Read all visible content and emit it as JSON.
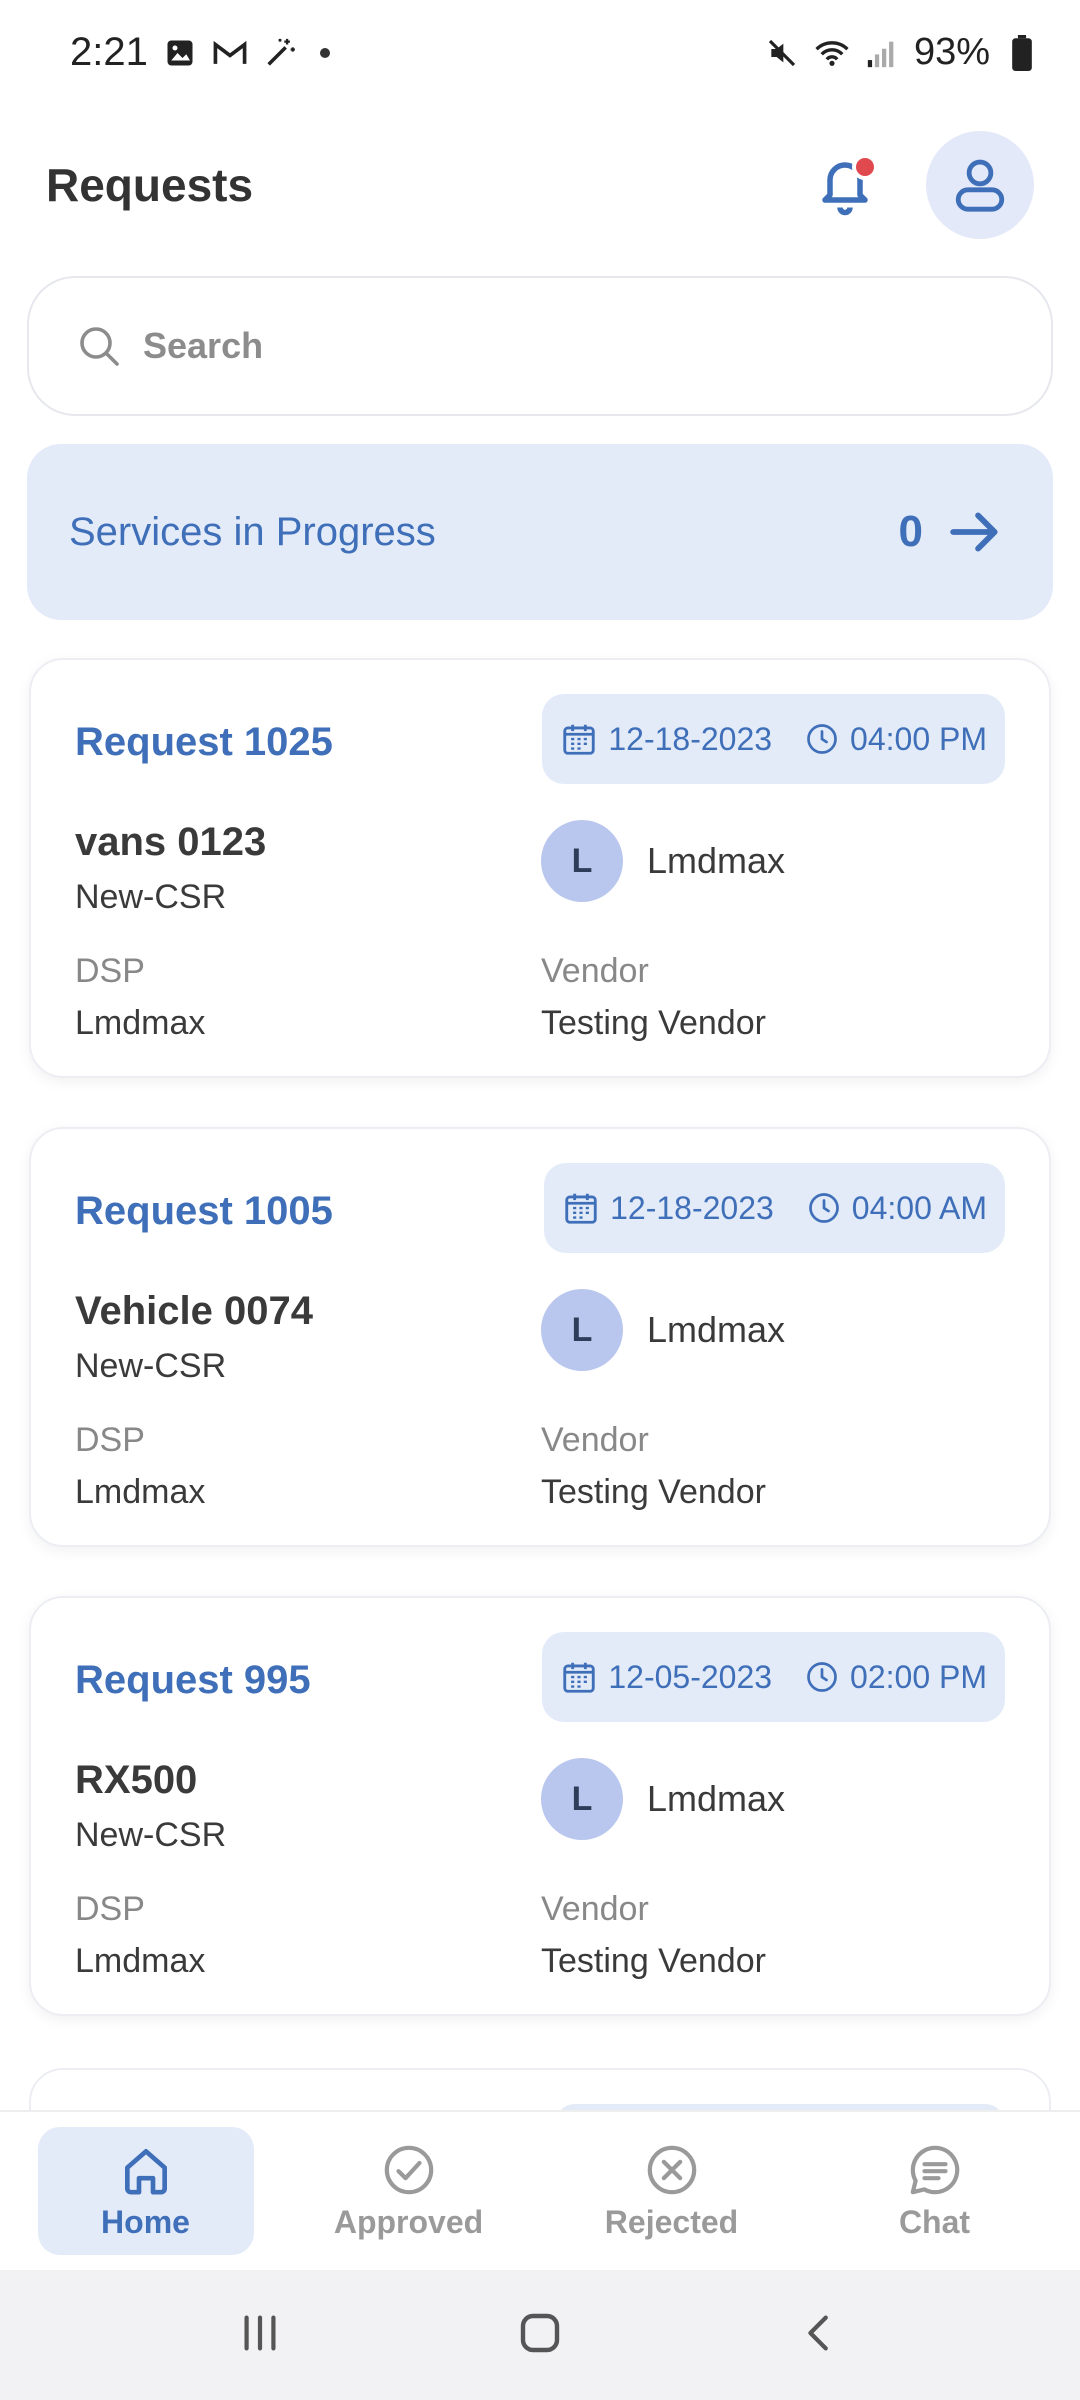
{
  "status_bar": {
    "time": "2:21",
    "battery": "93%"
  },
  "header": {
    "title": "Requests"
  },
  "search": {
    "placeholder": "Search"
  },
  "banner": {
    "label": "Services in Progress",
    "count": "0"
  },
  "cards": [
    {
      "title": "Request 1025",
      "date": "12-18-2023",
      "time": "04:00 PM",
      "vehicle": "vans 0123",
      "subtype": "New-CSR",
      "person_initial": "L",
      "person_name": "Lmdmax",
      "dsp_label": "DSP",
      "dsp_value": "Lmdmax",
      "vendor_label": "Vendor",
      "vendor_value": "Testing Vendor"
    },
    {
      "title": "Request 1005",
      "date": "12-18-2023",
      "time": "04:00 AM",
      "vehicle": "Vehicle 0074",
      "subtype": "New-CSR",
      "person_initial": "L",
      "person_name": "Lmdmax",
      "dsp_label": "DSP",
      "dsp_value": "Lmdmax",
      "vendor_label": "Vendor",
      "vendor_value": "Testing Vendor"
    },
    {
      "title": "Request 995",
      "date": "12-05-2023",
      "time": "02:00 PM",
      "vehicle": "RX500",
      "subtype": "New-CSR",
      "person_initial": "L",
      "person_name": "Lmdmax",
      "dsp_label": "DSP",
      "dsp_value": "Lmdmax",
      "vendor_label": "Vendor",
      "vendor_value": "Testing Vendor"
    }
  ],
  "bottom_nav": {
    "items": [
      {
        "label": "Home",
        "icon": "home-icon",
        "active": true
      },
      {
        "label": "Approved",
        "icon": "check-circle-icon",
        "active": false
      },
      {
        "label": "Rejected",
        "icon": "x-circle-icon",
        "active": false
      },
      {
        "label": "Chat",
        "icon": "chat-icon",
        "active": false
      }
    ]
  },
  "colors": {
    "accent": "#3f6fb8",
    "accent_bg": "#e3ebf9",
    "notification": "#e04a4f",
    "avatar": "#b9c7ee"
  }
}
